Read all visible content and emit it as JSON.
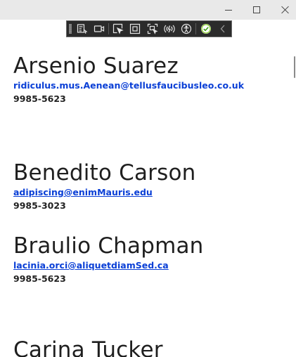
{
  "window": {
    "controls": {
      "minimize_icon": "minimize-icon",
      "maximize_icon": "maximize-icon",
      "close_icon": "close-icon"
    }
  },
  "toolbar": {
    "items": [
      {
        "icon": "live-visual-tree-icon"
      },
      {
        "icon": "video-camera-icon"
      },
      {
        "icon": "select-element-icon"
      },
      {
        "icon": "display-layout-adorners-icon"
      },
      {
        "icon": "track-focus-icon"
      },
      {
        "icon": "hot-reload-icon"
      },
      {
        "icon": "accessibility-icon"
      },
      {
        "icon": "check-circle-icon"
      },
      {
        "icon": "collapse-chevron-icon"
      }
    ],
    "accent_color": "#7ec61b"
  },
  "contacts": [
    {
      "name": "Arsenio Suarez",
      "email": "ridiculus.mus.Aenean@tellusfaucibusleo.co.uk",
      "phone": "9985-5623"
    },
    {
      "name": "Benedito Carson",
      "email": "adipiscing@enimMauris.edu",
      "phone": "9985-3023"
    },
    {
      "name": "Braulio Chapman",
      "email": "lacinia.orci@aliquetdiamSed.ca",
      "phone": "9985-5623"
    },
    {
      "name": "Carina Tucker",
      "email": "",
      "phone": ""
    }
  ],
  "colors": {
    "name": "#1f1f1f",
    "email_link": "#0a3fd6",
    "phone": "#222222",
    "titlebar": "#e9e9e9"
  }
}
